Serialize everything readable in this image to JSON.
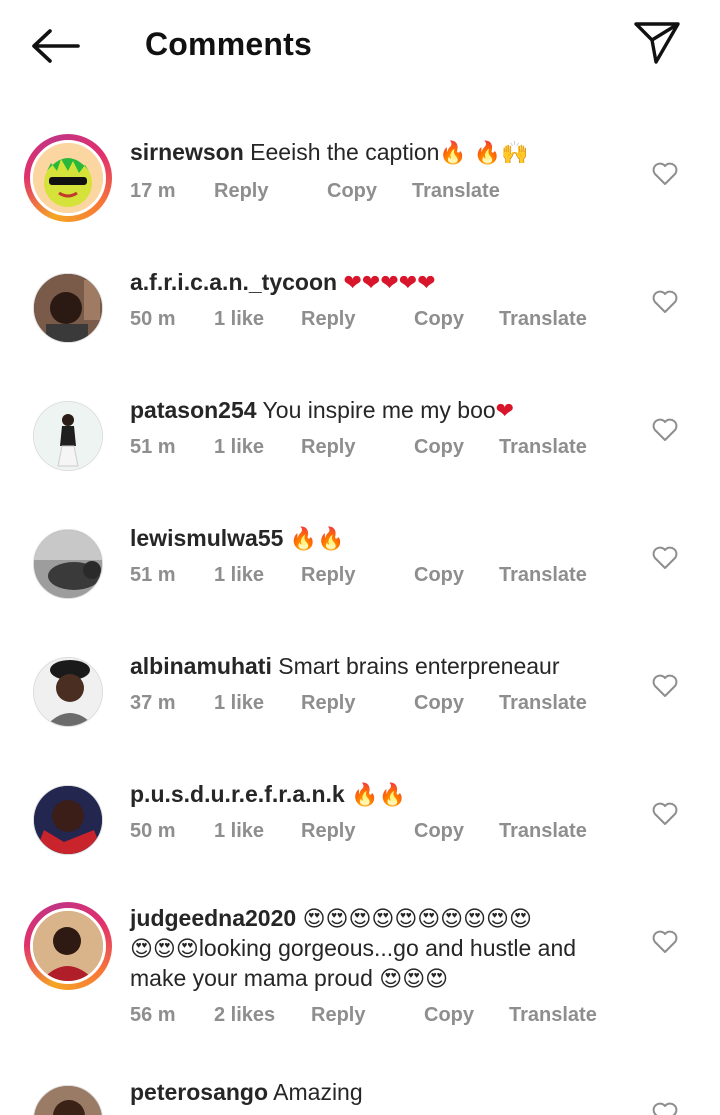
{
  "header": {
    "title": "Comments"
  },
  "comments": [
    {
      "username": "sirnewson",
      "text": "Eeeish the caption",
      "emojis": "🔥 🔥🙌",
      "time": "17 m",
      "likes": "",
      "reply": "Reply",
      "copy": "Copy",
      "translate": "Translate"
    },
    {
      "username": "a.f.r.i.c.a.n._tycoon",
      "text": "",
      "emojis": "❤❤❤❤❤",
      "time": "50 m",
      "likes": "1 like",
      "reply": "Reply",
      "copy": "Copy",
      "translate": "Translate"
    },
    {
      "username": "patason254",
      "text": "You inspire me my boo",
      "emojis": "❤",
      "time": "51 m",
      "likes": "1 like",
      "reply": "Reply",
      "copy": "Copy",
      "translate": "Translate"
    },
    {
      "username": "lewismulwa55",
      "text": "",
      "emojis": "🔥🔥",
      "time": "51 m",
      "likes": "1 like",
      "reply": "Reply",
      "copy": "Copy",
      "translate": "Translate"
    },
    {
      "username": "albinamuhati",
      "text": "Smart brains enterpreneaur",
      "emojis": "",
      "time": "37 m",
      "likes": "1 like",
      "reply": "Reply",
      "copy": "Copy",
      "translate": "Translate"
    },
    {
      "username": "p.u.s.d.u.r.e.f.r.a.n.k",
      "text": "",
      "emojis": "🔥🔥",
      "time": "50 m",
      "likes": "1 like",
      "reply": "Reply",
      "copy": "Copy",
      "translate": "Translate"
    },
    {
      "username": "judgeedna2020",
      "emojis_line1": "😍😍😍😍😍😍😍😍😍😍",
      "emojis_line2": "😍😍😍",
      "text_line2": "looking gorgeous...go and hustle and",
      "text_line3": "make your mama proud",
      "emojis_line3": "😍😍😍",
      "time": "56 m",
      "likes": "2 likes",
      "reply": "Reply",
      "copy": "Copy",
      "translate": "Translate"
    },
    {
      "username": "peterosango",
      "text": "Amazing"
    }
  ],
  "colors": {
    "text": "#262626",
    "meta": "#8e8e8e",
    "heart_red": "#d8152a"
  }
}
